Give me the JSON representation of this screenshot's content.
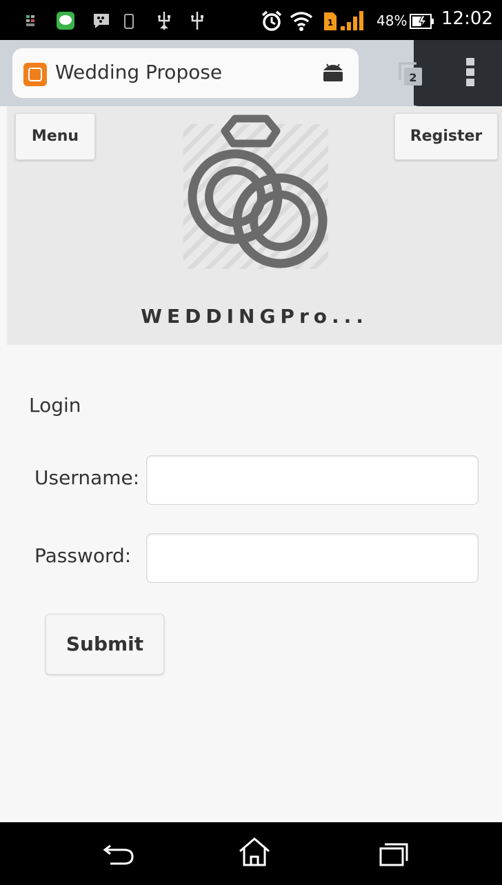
{
  "status_bar": {
    "battery_percent": "48%",
    "time": "12:02",
    "icons": [
      "signal-apps-icon",
      "line-icon",
      "bbm-icon",
      "phone-icon",
      "usb-icon",
      "usb-debug-icon",
      "alarm-icon",
      "wifi-icon",
      "sim-icon",
      "cell-signal-icon",
      "battery-charging-icon"
    ]
  },
  "browser": {
    "tab_title": "Wedding Propose",
    "tab_count": "2",
    "favicon_color": "#f07f1b"
  },
  "header": {
    "menu_label": "Menu",
    "register_label": "Register",
    "brand_text": "WEDDINGPro..."
  },
  "login": {
    "heading": "Login",
    "username_label": "Username:",
    "username_value": "",
    "password_label": "Password:",
    "password_value": "",
    "submit_label": "Submit"
  },
  "nav": {
    "icons": [
      "back-icon",
      "home-icon",
      "recent-apps-icon"
    ]
  }
}
